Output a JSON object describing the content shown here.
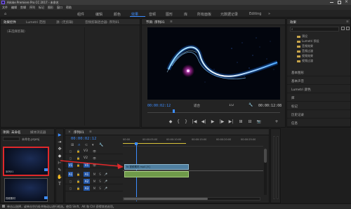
{
  "window": {
    "title": "Adobe Premiere Pro CC 2017 - 未命名"
  },
  "menubar": {
    "items": [
      "文件",
      "编辑",
      "剪辑",
      "序列",
      "标记",
      "图形",
      "窗口",
      "帮助"
    ]
  },
  "workspaces": {
    "items": [
      "组件",
      "编辑",
      "颜色",
      "效果",
      "音频",
      "图形",
      "库",
      "所有面板",
      "元数据记录",
      "Editing"
    ],
    "active": "效果"
  },
  "source_panel": {
    "tabs": [
      "效果控件",
      "Lumetri 范围",
      "源: (无剪辑)",
      "音频剪辑混合器: 序列01"
    ],
    "empty_label": "（未选择剪辑）"
  },
  "program_monitor": {
    "title": "节目: 序列01",
    "timecode_current": "00:00:02:12",
    "timecode_total": "00:00:12:08",
    "zoom": "适合",
    "quality": "1/2",
    "controls": [
      "◆",
      "{",
      "}",
      "|◀",
      "◀|",
      "▶",
      "|▶",
      "▶|",
      "⊞",
      "⊟",
      "📷",
      "+"
    ]
  },
  "effects_panel": {
    "title": "效果",
    "search_placeholder": "",
    "tree": [
      "预设",
      "Lumetri 预设",
      "音频效果",
      "音频过渡",
      "视频效果",
      "视频过渡"
    ],
    "sections": [
      "基本图形",
      "基本声音",
      "Lumetri 颜色",
      "库",
      "标记",
      "历史记录",
      "信息"
    ]
  },
  "project_panel": {
    "title": "项目: 未命名",
    "subtitle": "媒体浏览器",
    "search_placeholder": "",
    "item_name": "未命名.prproj",
    "thumbs": [
      "序列01",
      "视频素材"
    ]
  },
  "timeline": {
    "title": "序列01",
    "timecode": "00:00:02:12",
    "ruler": [
      "00:00",
      "00:00:05:00",
      "00:00:10:00",
      "00:00:15:00",
      "00:00:20:00",
      "00:00:25:00"
    ],
    "tracks": [
      {
        "name": "V3",
        "type": "video"
      },
      {
        "name": "V2",
        "type": "video"
      },
      {
        "name": "V1",
        "type": "video"
      },
      {
        "name": "A1",
        "type": "audio"
      },
      {
        "name": "A2",
        "type": "audio"
      },
      {
        "name": "A3",
        "type": "audio"
      }
    ],
    "clip_label": "fx 视频素材.mp4 [V]"
  },
  "status": {
    "text": "单击以选择，或单击空白处并拖动以进行框选。使用 Shift、Alt 和 Ctrl 获得其他选项。"
  },
  "colors": {
    "accent": "#3d8dff",
    "highlight_box": "#e0282a",
    "arrow": "#e0282a",
    "clip_video": "#4f7fa0",
    "clip_audio": "#6f9a4a"
  }
}
